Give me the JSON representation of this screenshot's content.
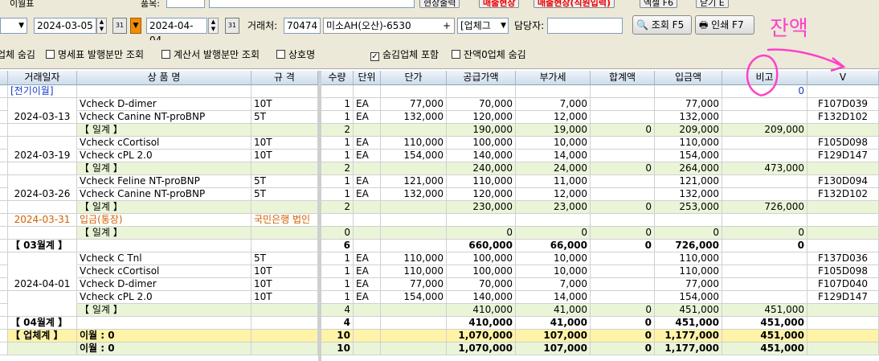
{
  "top_strip": {
    "left_label": "이월표",
    "mid_label": "품목:",
    "buttons": [
      "현장출력",
      "매출현장",
      "매출현장(직원입력)",
      "엑셀 F6",
      "닫기 E"
    ]
  },
  "toolbar": {
    "date_from": "2024-03-05",
    "date_to": "2024-04-04",
    "cal_label": "31",
    "client_label": "거래처:",
    "client_code": "70474",
    "client_name": "미소AH(오산)-6530",
    "plus": "+",
    "business_select": "[업체그",
    "manager_label": "담당자:",
    "manager_value": "",
    "search_button": "조회 F5",
    "print_button": "인쇄 F7"
  },
  "options": [
    {
      "label": "업체 숨김",
      "checked": false,
      "has_box": false
    },
    {
      "label": "명세표 발행분만 조회",
      "checked": false,
      "has_box": true
    },
    {
      "label": "계산서 발행분만 조회",
      "checked": false,
      "has_box": true
    },
    {
      "label": "상호명",
      "checked": false,
      "has_box": true
    },
    {
      "label": "숨김업체 포함",
      "checked": true,
      "has_box": true
    },
    {
      "label": "잔액0업체 숨김",
      "checked": false,
      "has_box": true
    }
  ],
  "columns": [
    "거래일자",
    "상 품 명",
    "규 격",
    "수량",
    "단위",
    "단가",
    "공급가액",
    "부가세",
    "합계액",
    "입금액",
    "비고",
    "V"
  ],
  "rows": [
    {
      "type": "carry",
      "cells": [
        "[전기이월]",
        "",
        "",
        "",
        "",
        "",
        "",
        "",
        "",
        "",
        "0",
        ""
      ]
    },
    {
      "type": "item",
      "cells": [
        "",
        "Vcheck D-dimer",
        "10T",
        "1",
        "EA",
        "77,000",
        "70,000",
        "7,000",
        "",
        "77,000",
        "",
        "F107D039"
      ]
    },
    {
      "type": "item",
      "cells": [
        "2024-03-13",
        "Vcheck Canine NT-proBNP",
        "5T",
        "1",
        "EA",
        "132,000",
        "120,000",
        "12,000",
        "",
        "132,000",
        "",
        "F132D102"
      ]
    },
    {
      "type": "sub",
      "cells": [
        "",
        "【 일계 】",
        "",
        "2",
        "",
        "",
        "190,000",
        "19,000",
        "0",
        "209,000",
        "209,000",
        ""
      ]
    },
    {
      "type": "item",
      "cells": [
        "",
        "Vcheck cCortisol",
        "10T",
        "1",
        "EA",
        "110,000",
        "100,000",
        "10,000",
        "",
        "110,000",
        "",
        "F105D098"
      ]
    },
    {
      "type": "item",
      "cells": [
        "2024-03-19",
        "Vcheck cPL 2.0",
        "10T",
        "1",
        "EA",
        "154,000",
        "140,000",
        "14,000",
        "",
        "154,000",
        "",
        "F129D147"
      ]
    },
    {
      "type": "sub",
      "cells": [
        "",
        "【 일계 】",
        "",
        "2",
        "",
        "",
        "240,000",
        "24,000",
        "0",
        "264,000",
        "473,000",
        ""
      ]
    },
    {
      "type": "item",
      "cells": [
        "",
        "Vcheck Feline NT-proBNP",
        "5T",
        "1",
        "EA",
        "121,000",
        "110,000",
        "11,000",
        "",
        "121,000",
        "",
        "F130D094"
      ]
    },
    {
      "type": "item",
      "cells": [
        "2024-03-26",
        "Vcheck Canine NT-proBNP",
        "5T",
        "1",
        "EA",
        "132,000",
        "120,000",
        "12,000",
        "",
        "132,000",
        "",
        "F132D102"
      ]
    },
    {
      "type": "sub",
      "cells": [
        "",
        "【 일계 】",
        "",
        "2",
        "",
        "",
        "230,000",
        "23,000",
        "0",
        "253,000",
        "726,000",
        ""
      ]
    },
    {
      "type": "pay",
      "cells": [
        "2024-03-31",
        "입금(통장)",
        "국민은행 법인",
        "",
        "",
        "",
        "",
        "",
        "",
        "",
        "",
        ""
      ]
    },
    {
      "type": "sub",
      "cells": [
        "",
        "【 일계 】",
        "",
        "0",
        "",
        "",
        "0",
        "0",
        "0",
        "0",
        "0",
        ""
      ]
    },
    {
      "type": "mon",
      "cells": [
        "【 03월계 】",
        "",
        "",
        "6",
        "",
        "",
        "660,000",
        "66,000",
        "0",
        "726,000",
        "0",
        ""
      ]
    },
    {
      "type": "item",
      "cells": [
        "",
        "Vcheck C Tnl",
        "5T",
        "1",
        "EA",
        "110,000",
        "100,000",
        "10,000",
        "",
        "110,000",
        "",
        "F137D036"
      ]
    },
    {
      "type": "item",
      "cells": [
        "",
        "Vcheck cCortisol",
        "10T",
        "1",
        "EA",
        "110,000",
        "100,000",
        "10,000",
        "",
        "110,000",
        "",
        "F105D098"
      ]
    },
    {
      "type": "item",
      "cells": [
        "2024-04-01",
        "Vcheck D-dimer",
        "10T",
        "1",
        "EA",
        "77,000",
        "70,000",
        "7,000",
        "",
        "77,000",
        "",
        "F107D040"
      ]
    },
    {
      "type": "item",
      "cells": [
        "",
        "Vcheck cPL 2.0",
        "10T",
        "1",
        "EA",
        "154,000",
        "140,000",
        "14,000",
        "",
        "154,000",
        "",
        "F129D147"
      ]
    },
    {
      "type": "sub",
      "cells": [
        "",
        "【 일계 】",
        "",
        "4",
        "",
        "",
        "410,000",
        "41,000",
        "0",
        "451,000",
        "451,000",
        ""
      ]
    },
    {
      "type": "mon",
      "cells": [
        "【 04월계 】",
        "",
        "",
        "4",
        "",
        "",
        "410,000",
        "41,000",
        "0",
        "451,000",
        "451,000",
        ""
      ]
    },
    {
      "type": "tot",
      "cells": [
        "【 업체계 】",
        "이월 : 0",
        "",
        "10",
        "",
        "",
        "1,070,000",
        "107,000",
        "0",
        "1,177,000",
        "451,000",
        ""
      ]
    },
    {
      "type": "gt",
      "cells": [
        "",
        "이월 : 0",
        "",
        "10",
        "",
        "",
        "1,070,000",
        "107,000",
        "0",
        "1,177,000",
        "451,000",
        ""
      ]
    }
  ],
  "annotation": {
    "text": "잔액",
    "color": "#ff40c8"
  }
}
